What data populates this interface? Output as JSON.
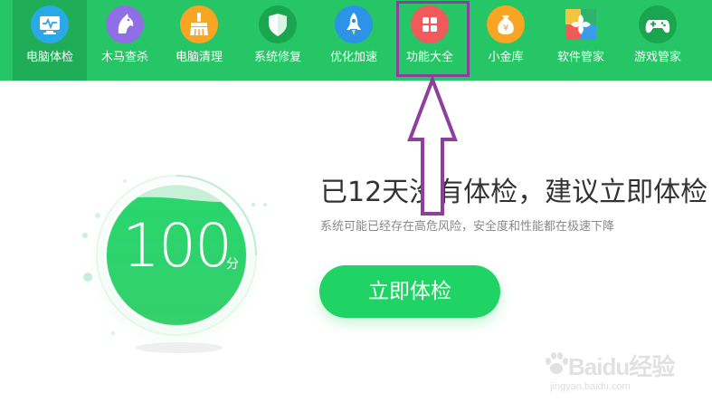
{
  "nav": {
    "items": [
      {
        "label": "电脑体检",
        "icon": "monitor-icon",
        "color": "#2aa8e8",
        "active": true
      },
      {
        "label": "木马查杀",
        "icon": "horse-icon",
        "color": "#8f6ee6",
        "active": false
      },
      {
        "label": "电脑清理",
        "icon": "broom-icon",
        "color": "#f7a522",
        "active": false
      },
      {
        "label": "系统修复",
        "icon": "shield-icon",
        "color": "#19a64e",
        "active": false
      },
      {
        "label": "优化加速",
        "icon": "rocket-icon",
        "color": "#2b93e8",
        "active": false
      },
      {
        "label": "功能大全",
        "icon": "grid-icon",
        "color": "#f05a5a",
        "active": false
      },
      {
        "label": "小金库",
        "icon": "money-bag-icon",
        "color": "#f7a522",
        "active": false
      },
      {
        "label": "软件管家",
        "icon": "app-store-icon",
        "color": "#f0a030",
        "active": false
      },
      {
        "label": "游戏管家",
        "icon": "gamepad-icon",
        "color": "#1aa64e",
        "active": false
      }
    ]
  },
  "score": {
    "value": "100",
    "unit": "分",
    "fill_percent": 90
  },
  "message": {
    "headline": "已12天没有体检，建议立即体检！",
    "subline": "系统可能已经存在高危风险，安全度和性能都在极速下降"
  },
  "check_button": {
    "label": "立即体检"
  },
  "watermark": {
    "brand": "Baidu经验",
    "url": "jingyan.baidu.com"
  },
  "colors": {
    "topbar": "#26c566",
    "accent": "#1fd465",
    "annotation": "#8e3f9e"
  }
}
